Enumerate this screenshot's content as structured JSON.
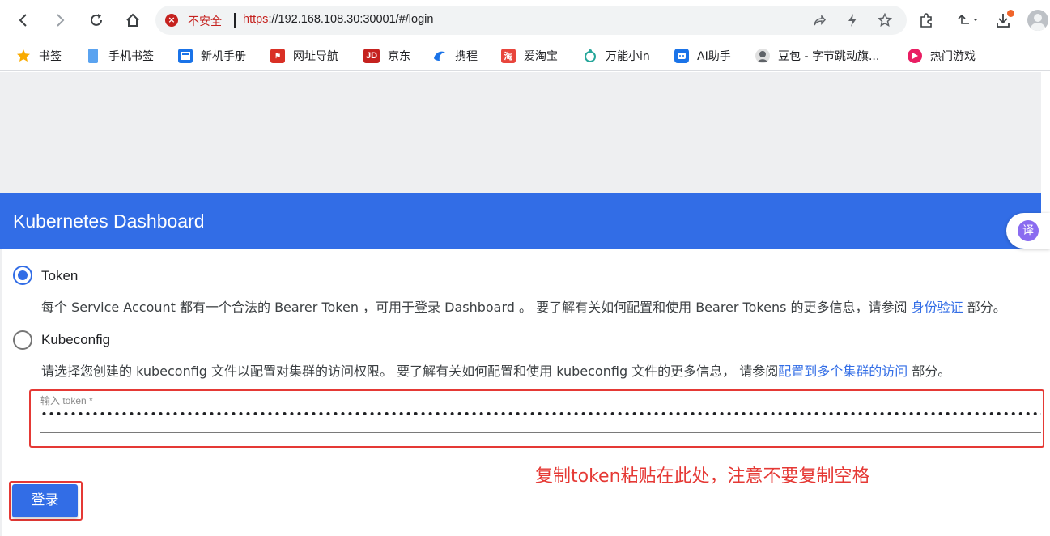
{
  "browser": {
    "security_label": "不安全",
    "url_scheme": "https",
    "url_rest": "://192.168.108.30:30001/#/login"
  },
  "bookmarks": [
    {
      "label": "书签",
      "icon": "star-icon",
      "color": "#f9ab00"
    },
    {
      "label": "手机书签",
      "icon": "phone-icon",
      "color": "#5aa3f0"
    },
    {
      "label": "新机手册",
      "icon": "manual-icon",
      "color": "#1a73e8"
    },
    {
      "label": "网址导航",
      "icon": "nav-icon",
      "color": "#d93025"
    },
    {
      "label": "京东",
      "icon": "jd-icon",
      "color": "#c5221f",
      "glyph": "JD"
    },
    {
      "label": "携程",
      "icon": "ctrip-icon",
      "color": "#1a73e8"
    },
    {
      "label": "爱淘宝",
      "icon": "taobao-icon",
      "color": "#e8453c",
      "glyph": "淘"
    },
    {
      "label": "万能小in",
      "icon": "wannengin-icon",
      "color": "#26a69a"
    },
    {
      "label": "AI助手",
      "icon": "ai-assistant-icon",
      "color": "#1a73e8"
    },
    {
      "label": "豆包 - 字节跳动旗...",
      "icon": "doubao-icon",
      "color": "#5f6368"
    },
    {
      "label": "热门游戏",
      "icon": "game-icon",
      "color": "#e91e63"
    }
  ],
  "page": {
    "header_title": "Kubernetes Dashboard",
    "translate_glyph": "译",
    "token_option": {
      "label": "Token",
      "desc_before": "每个 Service Account 都有一个合法的 Bearer Token ，可用于登录 Dashboard 。 要了解有关如何配置和使用 Bearer Tokens 的更多信息，请参阅 ",
      "desc_link": "身份验证",
      "desc_after": " 部分。"
    },
    "kubeconfig_option": {
      "label": "Kubeconfig",
      "desc_before": "请选择您创建的 kubeconfig 文件以配置对集群的访问权限。 要了解有关如何配置和使用 kubeconfig 文件的更多信息， 请参阅",
      "desc_link": "配置到多个集群的访问",
      "desc_after": " 部分。"
    },
    "token_input": {
      "label": "输入 token *",
      "masked_value": "•••••••••••••••••••••••••••••••••••••••••••••••••••••••••••••••••••••••••••••••••••••••••••••••••••••••••••••••••••••••••••••••••••••••••••••••••••••••••••••••••••••••••••••••••••••••"
    },
    "annotation": "复制token粘贴在此处，注意不要复制空格",
    "login_label": "登录"
  },
  "colors": {
    "brand_blue": "#326de6",
    "annotation_red": "#e53935"
  }
}
